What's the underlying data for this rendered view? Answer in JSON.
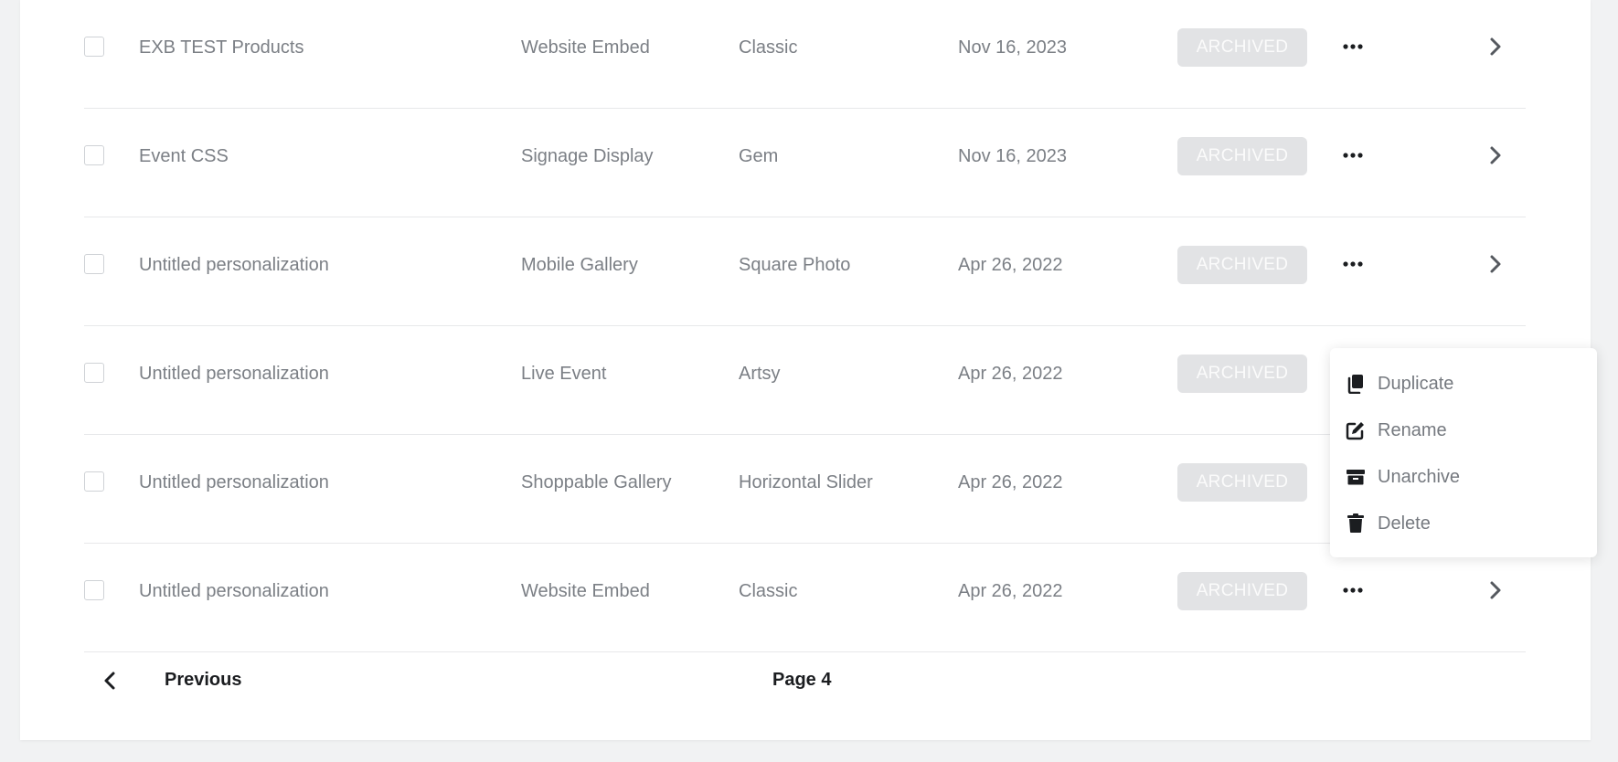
{
  "rows": [
    {
      "name": "EXB TEST Products",
      "type": "Website Embed",
      "layout": "Classic",
      "date": "Nov 16, 2023",
      "status": "ARCHIVED"
    },
    {
      "name": "Event CSS",
      "type": "Signage Display",
      "layout": "Gem",
      "date": "Nov 16, 2023",
      "status": "ARCHIVED"
    },
    {
      "name": "Untitled personalization",
      "type": "Mobile Gallery",
      "layout": "Square Photo",
      "date": "Apr 26, 2022",
      "status": "ARCHIVED"
    },
    {
      "name": "Untitled personalization",
      "type": "Live Event",
      "layout": "Artsy",
      "date": "Apr 26, 2022",
      "status": "ARCHIVED"
    },
    {
      "name": "Untitled personalization",
      "type": "Shoppable Gallery",
      "layout": "Horizontal Slider",
      "date": "Apr 26, 2022",
      "status": "ARCHIVED"
    },
    {
      "name": "Untitled personalization",
      "type": "Website Embed",
      "layout": "Classic",
      "date": "Apr 26, 2022",
      "status": "ARCHIVED"
    }
  ],
  "pagination": {
    "previous_label": "Previous",
    "page_label": "Page 4"
  },
  "context_menu": {
    "items": [
      {
        "label": "Duplicate",
        "icon": "duplicate-icon"
      },
      {
        "label": "Rename",
        "icon": "edit-icon"
      },
      {
        "label": "Unarchive",
        "icon": "archive-box-icon"
      },
      {
        "label": "Delete",
        "icon": "trash-icon"
      }
    ]
  },
  "colors": {
    "badge_bg": "#e2e3e5",
    "badge_text": "#fbfbfb",
    "cell_text": "#7b7f85",
    "icon_dark": "#1b1d20"
  }
}
